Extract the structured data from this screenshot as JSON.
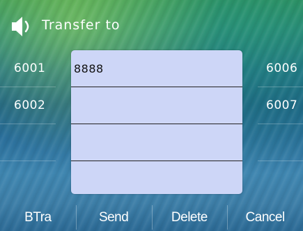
{
  "header": {
    "title": "Transfer to",
    "icon": "speaker-icon"
  },
  "left_list": [
    "6001",
    "6002",
    "",
    ""
  ],
  "right_list": [
    "6006",
    "6007",
    "",
    ""
  ],
  "dialog": {
    "fields": [
      "8888",
      "",
      "",
      ""
    ]
  },
  "softkeys": [
    "BTra",
    "Send",
    "Delete",
    "Cancel"
  ],
  "colors": {
    "dialog_bg": "#cdd6f7",
    "text_light": "#ffffff"
  }
}
